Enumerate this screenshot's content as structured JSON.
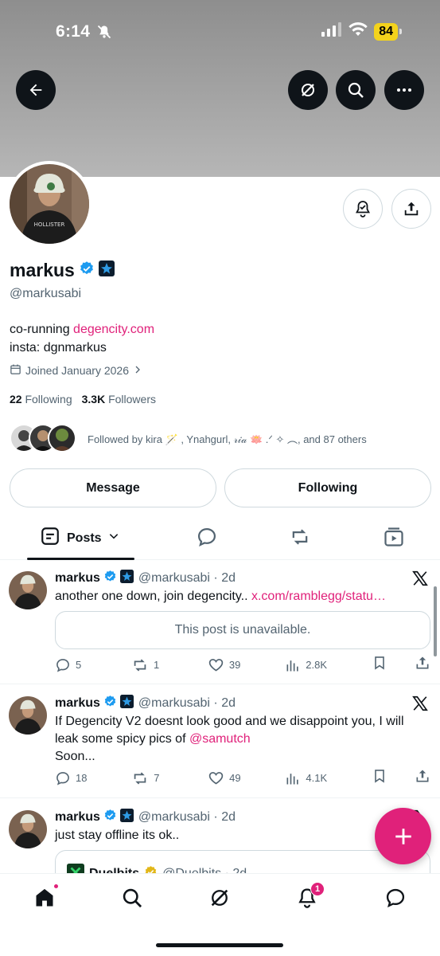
{
  "status_bar": {
    "time": "6:14",
    "battery": "84"
  },
  "profile": {
    "name": "markus",
    "handle": "@markusabi",
    "bio_prefix": "co-running ",
    "bio_link": "degencity.com",
    "bio_line2": "insta: dgnmarkus",
    "joined": "Joined January 2026",
    "following_count": "22",
    "following_label": "Following",
    "followers_count": "3.3K",
    "followers_label": "Followers",
    "followed_by": "Followed by kira 🪄 , Ynahgurl, 𝓇𝒾𝒶 🪷 .ᐟ ✧ ︵, and 87 others"
  },
  "buttons": {
    "message": "Message",
    "following": "Following"
  },
  "tabs": {
    "posts": "Posts"
  },
  "posts": [
    {
      "name": "markus",
      "meta": "@markusabi · 2d",
      "text_prefix": "another one down, join degencity.. ",
      "text_link": "x.com/ramblegg/statu…",
      "unavailable": "This post is unavailable.",
      "replies": "5",
      "reposts": "1",
      "likes": "39",
      "views": "2.8K"
    },
    {
      "name": "markus",
      "meta": "@markusabi · 2d",
      "text_prefix": "If Degencity V2 doesnt look good and we disappoint you, I will leak some spicy pics of ",
      "text_link": "@samutch",
      "text_suffix": "Soon...",
      "replies": "18",
      "reposts": "7",
      "likes": "49",
      "views": "4.1K"
    },
    {
      "name": "markus",
      "meta": "@markusabi · 2d",
      "text_prefix": "just stay offline its ok..",
      "quote_name": "Duelbits",
      "quote_meta": "@Duelbits · 2d"
    }
  ],
  "notifications_badge": "1",
  "colors": {
    "accent": "#e0217a",
    "verified": "#1d9bf0",
    "text": "#0f1419",
    "muted": "#536471"
  }
}
